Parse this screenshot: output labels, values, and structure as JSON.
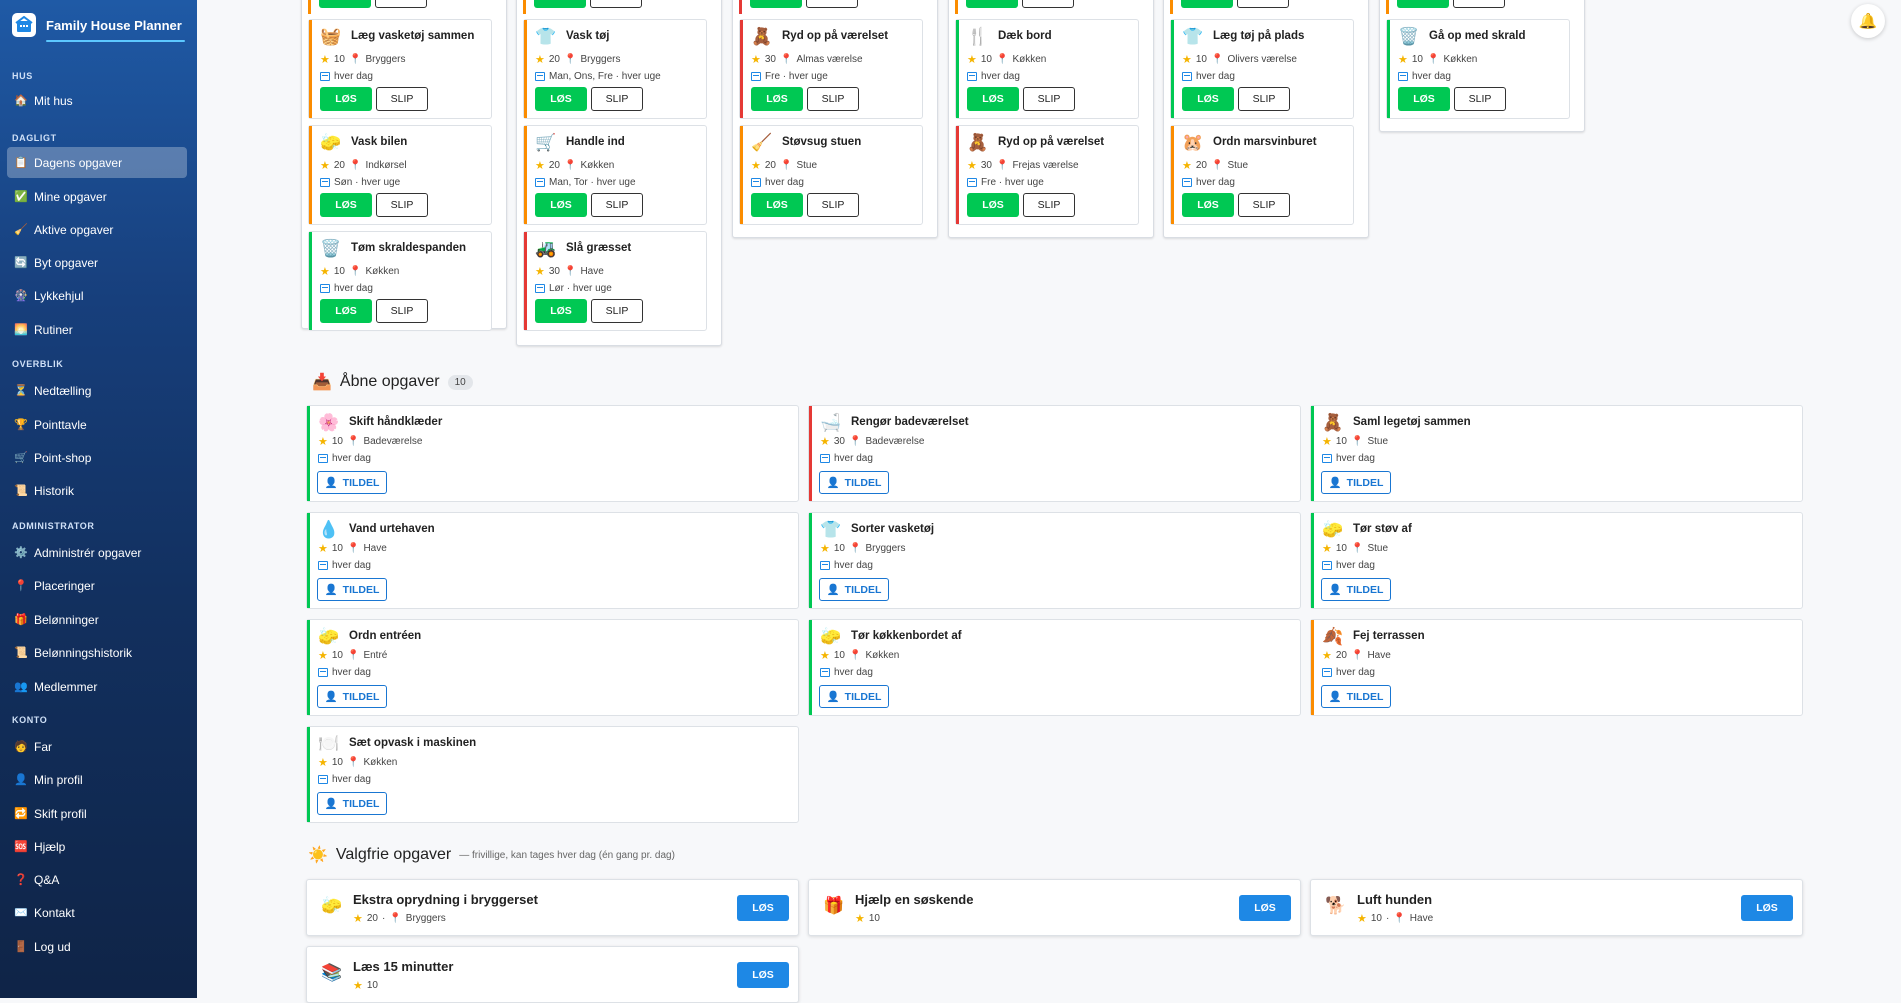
{
  "app": {
    "title": "Family House Planner"
  },
  "sidebar": {
    "sections": {
      "hus": "HUS",
      "dagligt": "DAGLIGT",
      "overblik": "OVERBLIK",
      "admin": "ADMINISTRATOR",
      "konto": "KONTO"
    },
    "items": [
      {
        "label": "Mit hus",
        "icon": "🏠"
      },
      {
        "label": "Dagens opgaver",
        "icon": "📋"
      },
      {
        "label": "Mine opgaver",
        "icon": "✅"
      },
      {
        "label": "Aktive opgaver",
        "icon": "🧹"
      },
      {
        "label": "Byt opgaver",
        "icon": "🔄"
      },
      {
        "label": "Lykkehjul",
        "icon": "🎡"
      },
      {
        "label": "Rutiner",
        "icon": "🌅"
      },
      {
        "label": "Nedtælling",
        "icon": "⏳"
      },
      {
        "label": "Pointtavle",
        "icon": "🏆"
      },
      {
        "label": "Point-shop",
        "icon": "🛒"
      },
      {
        "label": "Historik",
        "icon": "📜"
      },
      {
        "label": "Administrér opgaver",
        "icon": "⚙️"
      },
      {
        "label": "Placeringer",
        "icon": "📍"
      },
      {
        "label": "Belønninger",
        "icon": "🎁"
      },
      {
        "label": "Belønningshistorik",
        "icon": "📜"
      },
      {
        "label": "Medlemmer",
        "icon": "👥"
      },
      {
        "label": "Far",
        "icon": "🧑"
      },
      {
        "label": "Min profil",
        "icon": "👤"
      },
      {
        "label": "Skift profil",
        "icon": "🔁"
      },
      {
        "label": "Hjælp",
        "icon": "🆘"
      },
      {
        "label": "Q&A",
        "icon": "❓"
      },
      {
        "label": "Kontakt",
        "icon": "✉️"
      },
      {
        "label": "Log ud",
        "icon": "🚪"
      }
    ]
  },
  "buttons": {
    "los": "LØS",
    "slip": "SLIP",
    "tildel": "TILDEL"
  },
  "colors": {
    "green": "#00c853",
    "orange": "#fb8c00",
    "red": "#e53935",
    "blue": "#1e88e5"
  },
  "columns": [
    {
      "tasks": [
        {
          "emoji": "🧺",
          "title": "Læg vasketøj sammen",
          "points": "10",
          "place": "Bryggers",
          "freq": "hver dag",
          "accent": "orange"
        },
        {
          "emoji": "🧽",
          "title": "Vask bilen",
          "points": "20",
          "place": "Indkørsel",
          "freq": "Søn · hver uge",
          "accent": "orange"
        },
        {
          "emoji": "🗑️",
          "title": "Tøm skraldespanden",
          "points": "10",
          "place": "Køkken",
          "freq": "hver dag",
          "accent": "green"
        }
      ]
    },
    {
      "tasks": [
        {
          "emoji": "👕",
          "title": "Vask tøj",
          "points": "20",
          "place": "Bryggers",
          "freq": "Man, Ons, Fre · hver uge",
          "accent": "orange"
        },
        {
          "emoji": "🛒",
          "title": "Handle ind",
          "points": "20",
          "place": "Køkken",
          "freq": "Man, Tor · hver uge",
          "accent": "orange"
        },
        {
          "emoji": "🚜",
          "title": "Slå græsset",
          "points": "30",
          "place": "Have",
          "freq": "Lør · hver uge",
          "accent": "red"
        }
      ]
    },
    {
      "tasks": [
        {
          "emoji": "🧸",
          "title": "Ryd op på værelset",
          "points": "30",
          "place": "Almas værelse",
          "freq": "Fre · hver uge",
          "accent": "red"
        },
        {
          "emoji": "🧹",
          "title": "Støvsug stuen",
          "points": "20",
          "place": "Stue",
          "freq": "hver dag",
          "accent": "orange"
        }
      ]
    },
    {
      "tasks": [
        {
          "emoji": "🍴",
          "title": "Dæk bord",
          "points": "10",
          "place": "Køkken",
          "freq": "hver dag",
          "accent": "green"
        },
        {
          "emoji": "🧸",
          "title": "Ryd op på værelset",
          "points": "30",
          "place": "Frejas værelse",
          "freq": "Fre · hver uge",
          "accent": "red"
        }
      ]
    },
    {
      "tasks": [
        {
          "emoji": "👕",
          "title": "Læg tøj på plads",
          "points": "10",
          "place": "Olivers værelse",
          "freq": "hver dag",
          "accent": "green"
        },
        {
          "emoji": "🐹",
          "title": "Ordn marsvinburet",
          "points": "20",
          "place": "Stue",
          "freq": "hver dag",
          "accent": "orange"
        }
      ]
    },
    {
      "tasks": [
        {
          "emoji": "🗑️",
          "title": "Gå op med skrald",
          "points": "10",
          "place": "Køkken",
          "freq": "hver dag",
          "accent": "green"
        }
      ]
    }
  ],
  "open": {
    "title": "Åbne opgaver",
    "count": "10",
    "icon": "📥",
    "tasks": [
      {
        "emoji": "🌸",
        "title": "Skift håndklæder",
        "points": "10",
        "place": "Badeværelse",
        "freq": "hver dag",
        "accent": "green"
      },
      {
        "emoji": "🛁",
        "title": "Rengør badeværelset",
        "points": "30",
        "place": "Badeværelse",
        "freq": "hver dag",
        "accent": "red"
      },
      {
        "emoji": "🧸",
        "title": "Saml legetøj sammen",
        "points": "10",
        "place": "Stue",
        "freq": "hver dag",
        "accent": "green"
      },
      {
        "emoji": "💧",
        "title": "Vand urtehaven",
        "points": "10",
        "place": "Have",
        "freq": "hver dag",
        "accent": "green"
      },
      {
        "emoji": "👕",
        "title": "Sorter vasketøj",
        "points": "10",
        "place": "Bryggers",
        "freq": "hver dag",
        "accent": "green"
      },
      {
        "emoji": "🧽",
        "title": "Tør støv af",
        "points": "10",
        "place": "Stue",
        "freq": "hver dag",
        "accent": "green"
      },
      {
        "emoji": "🧽",
        "title": "Ordn entréen",
        "points": "10",
        "place": "Entré",
        "freq": "hver dag",
        "accent": "green"
      },
      {
        "emoji": "🧽",
        "title": "Tør køkkenbordet af",
        "points": "10",
        "place": "Køkken",
        "freq": "hver dag",
        "accent": "green"
      },
      {
        "emoji": "🍂",
        "title": "Fej terrassen",
        "points": "20",
        "place": "Have",
        "freq": "hver dag",
        "accent": "orange"
      },
      {
        "emoji": "🍽️",
        "title": "Sæt opvask i maskinen",
        "points": "10",
        "place": "Køkken",
        "freq": "hver dag",
        "accent": "green"
      }
    ]
  },
  "optional": {
    "title": "Valgfrie opgaver",
    "subtitle": "— frivillige, kan tages hver dag (én gang pr. dag)",
    "icon": "☀️",
    "tasks": [
      {
        "emoji": "🧽",
        "title": "Ekstra oprydning i bryggerset",
        "points": "20",
        "place": "Bryggers"
      },
      {
        "emoji": "🎁",
        "title": "Hjælp en søskende",
        "points": "10",
        "place": ""
      },
      {
        "emoji": "🐕",
        "title": "Luft hunden",
        "points": "10",
        "place": "Have"
      },
      {
        "emoji": "📚",
        "title": "Læs 15 minutter",
        "points": "10",
        "place": ""
      }
    ]
  }
}
